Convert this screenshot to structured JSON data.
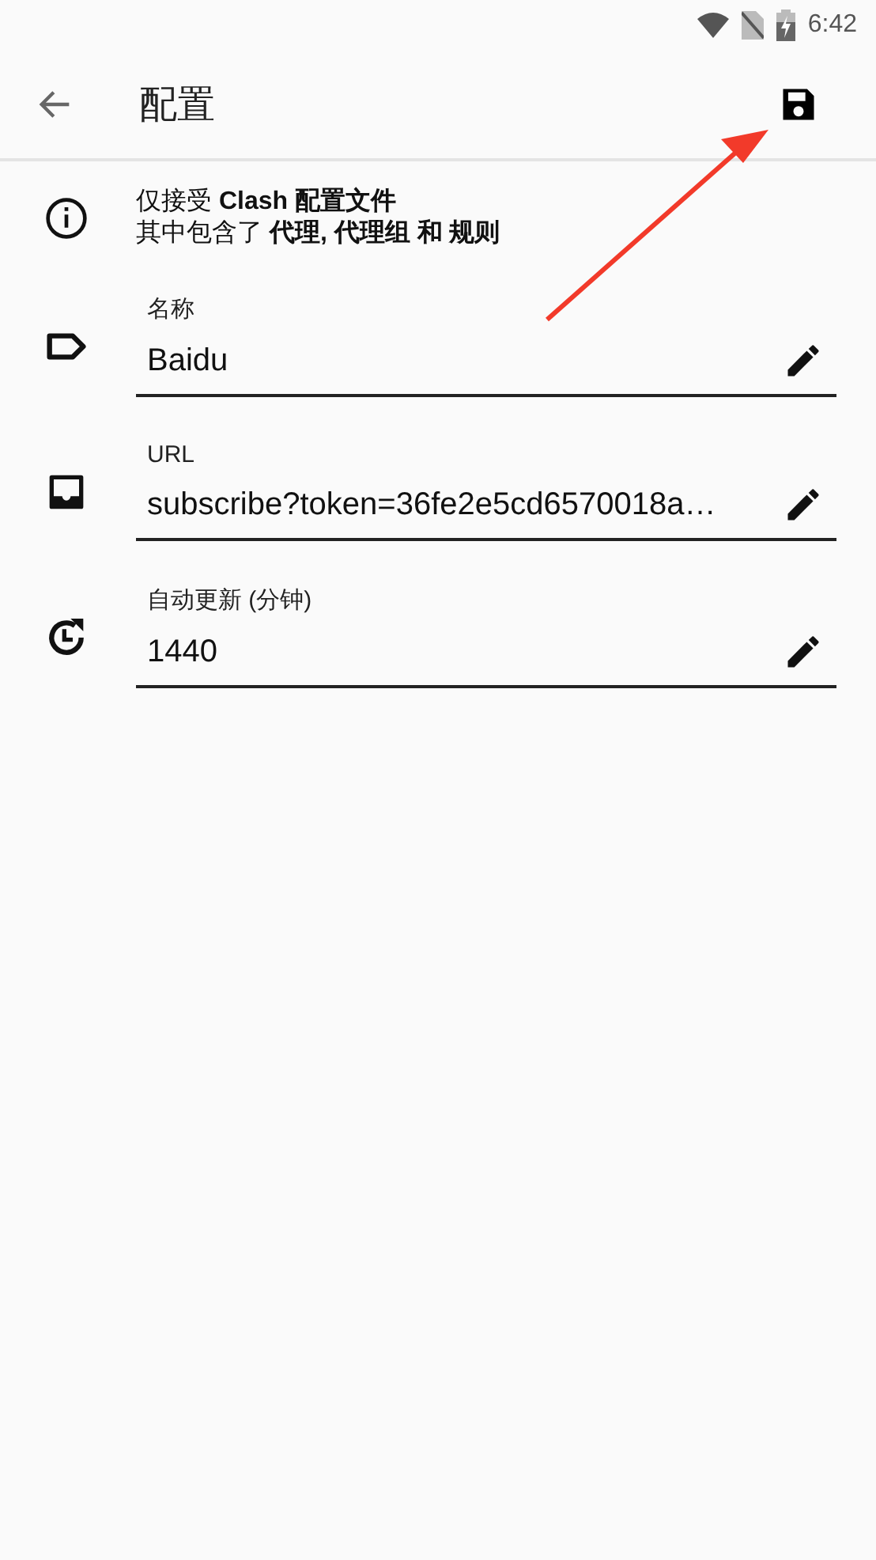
{
  "status_bar": {
    "time": "6:42"
  },
  "app_bar": {
    "title": "配置"
  },
  "notice": {
    "lines": [
      "仅接受 **Clash 配置文件**",
      "其中包含了 **代理, 代理组 和 规则**"
    ]
  },
  "fields": [
    {
      "label": "名称",
      "value": "Baidu"
    },
    {
      "label": "URL",
      "value": "subscribe?token=36fe2e5cd6570018a…"
    },
    {
      "label": "自动更新 (分钟)",
      "value": "1440"
    }
  ]
}
